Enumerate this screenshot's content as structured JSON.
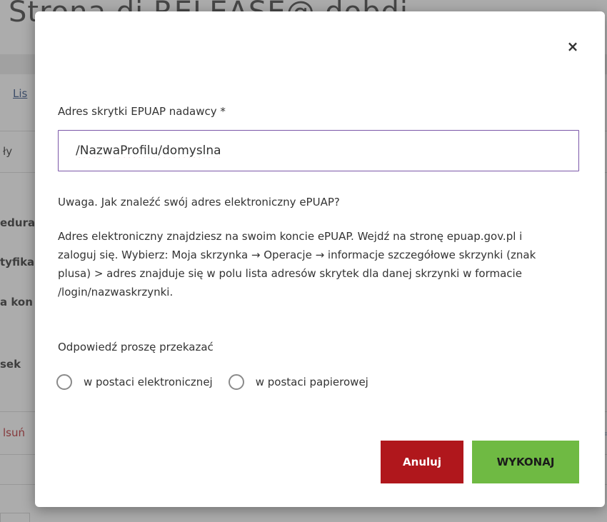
{
  "background": {
    "title": "Strona di RELEASE@ dobdi",
    "link": "Lis",
    "text_1": "ły",
    "text_2": "edura",
    "text_3": "tyfika",
    "text_4": "a kon",
    "text_5": "sek",
    "text_6": "lsuń"
  },
  "dialog": {
    "close_label": "×",
    "field": {
      "label": "Adres skrytki EPUAP nadawcy *",
      "value": "/NazwaProfilu/domyslna"
    },
    "help_title": "Uwaga. Jak znaleźć swój adres elektroniczny ePUAP?",
    "help_body": "Adres elektroniczny znajdziesz na swoim koncie ePUAP. Wejdź na stronę epuap.gov.pl i zaloguj się. Wybierz: Moja skrzynka → Operacje → informacje szczegółowe skrzynki (znak plusa) > adres znajduje się w polu lista adresów skrytek dla danej skrzynki w formacie /login/nazwaskrzynki.",
    "reply_label": "Odpowiedź proszę przekazać",
    "radio_options": [
      {
        "label": "w postaci elektronicznej",
        "selected": false
      },
      {
        "label": "w postaci papierowej",
        "selected": false
      }
    ],
    "buttons": {
      "cancel": "Anuluj",
      "submit": "WYKONAJ"
    }
  },
  "colors": {
    "cancel_button": "#b0171c",
    "submit_button": "#6fba43",
    "input_border": "#7b57a8",
    "overlay": "#5a5a5a"
  }
}
